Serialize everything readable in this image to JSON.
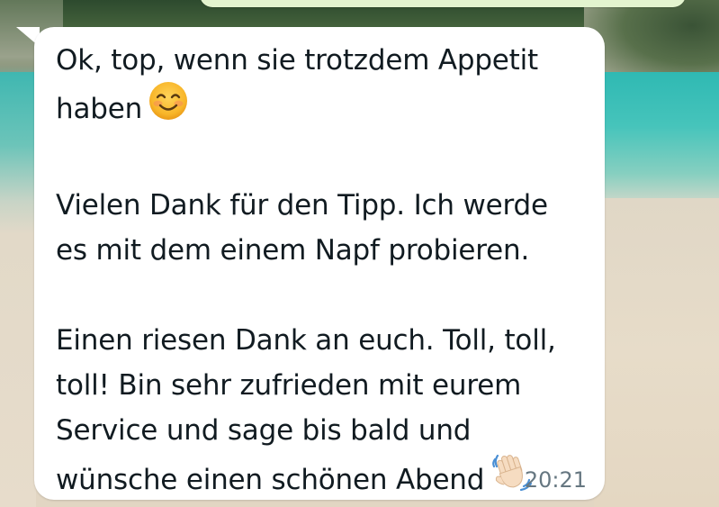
{
  "message": {
    "paragraphs": [
      {
        "lines": [
          "Ok, top, wenn sie trotzdem Appetit",
          "haben"
        ],
        "trailing_emoji": "smiling-face-icon"
      },
      {
        "lines": [
          "Vielen Dank für den Tipp. Ich werde",
          "es mit dem einem Napf probieren."
        ]
      },
      {
        "lines": [
          "Einen riesen Dank an euch. Toll, toll,",
          "toll! Bin sehr zufrieden mit eurem",
          "Service und sage bis bald und",
          "wünsche einen schönen Abend"
        ],
        "trailing_emoji": "waving-hand-icon"
      }
    ],
    "time": "20:21"
  },
  "colors": {
    "bubble_incoming": "#ffffff",
    "bubble_outgoing": "#e3f4cf",
    "text": "#111b21",
    "meta_text": "#667781"
  }
}
